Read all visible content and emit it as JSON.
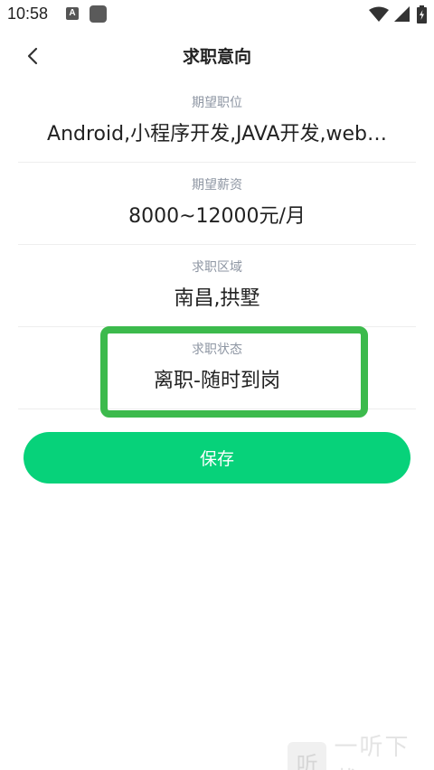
{
  "status_bar": {
    "time": "10:58",
    "notification_glyph": "A",
    "icons": [
      "notification-a-icon",
      "app-square-icon",
      "wifi-icon",
      "signal-icon",
      "battery-charging-icon"
    ]
  },
  "header": {
    "back_icon": "chevron-left-icon",
    "title": "求职意向"
  },
  "fields": [
    {
      "label": "期望职位",
      "value": "Android,小程序开发,JAVA开发,web…"
    },
    {
      "label": "期望薪资",
      "value": "8000~12000元/月"
    },
    {
      "label": "求职区域",
      "value": "南昌,拱墅"
    },
    {
      "label": "求职状态",
      "value": "离职-随时到岗"
    }
  ],
  "save_button": {
    "label": "保存"
  },
  "watermark": {
    "logo_glyph": "听",
    "text": "一听下载"
  },
  "colors": {
    "accent_green": "#07d27a",
    "highlight_green": "#3cba4c",
    "label_gray": "#8e96a3",
    "divider": "#eeeeee"
  }
}
